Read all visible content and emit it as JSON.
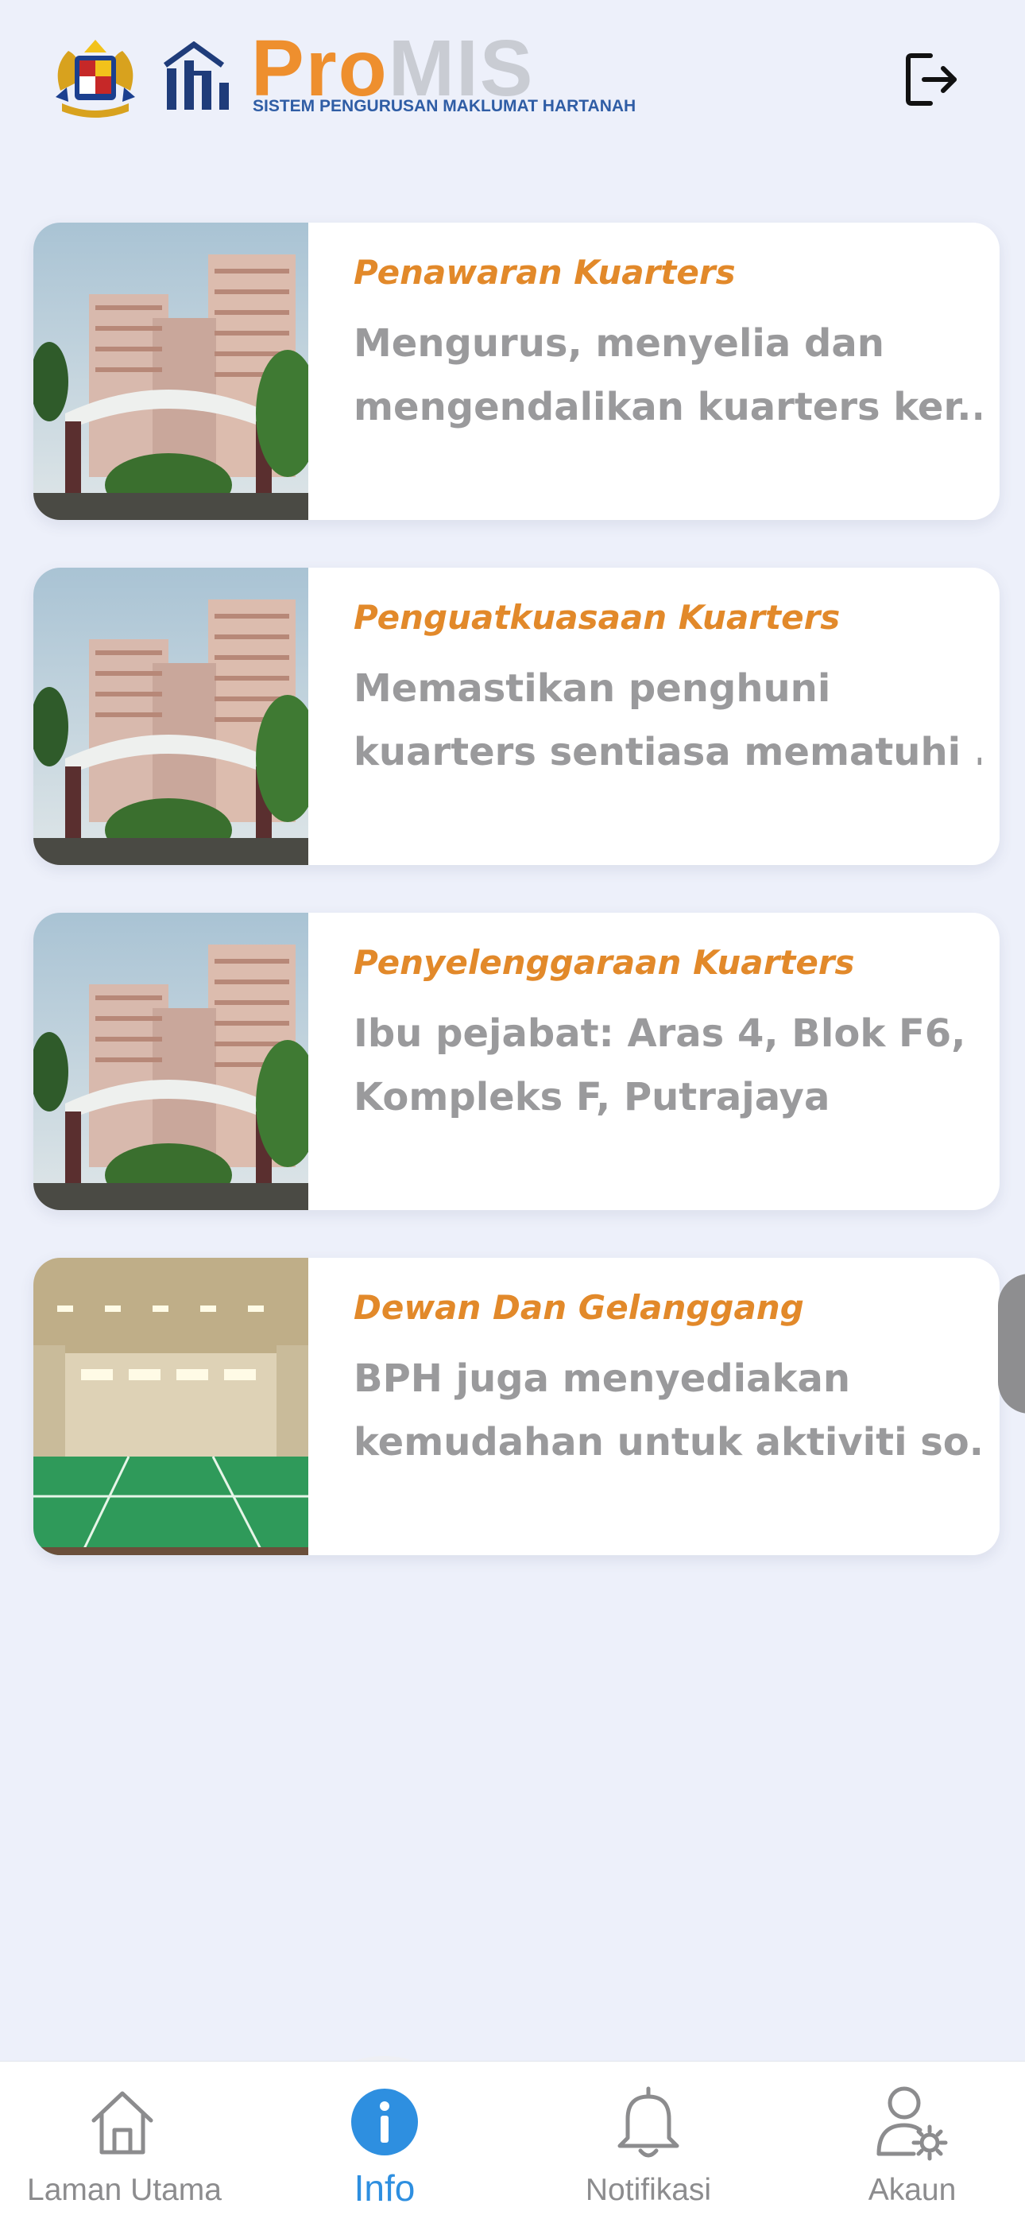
{
  "header": {
    "brand_pro": "Pro",
    "brand_mis": "MIS",
    "brand_subtitle": "SISTEM PENGURUSAN MAKLUMAT HARTANAH",
    "logout_icon": "logout-icon"
  },
  "cards": [
    {
      "title": "Penawaran Kuarters",
      "desc_line1": "Mengurus, menyelia dan",
      "desc_line2": "mengendalikan kuarters ker...",
      "image": "apartment-photo"
    },
    {
      "title": "Penguatkuasaan Kuarters",
      "desc_line1": "Memastikan penghuni",
      "desc_line2": "kuarters sentiasa mematuhi ...",
      "image": "apartment-photo"
    },
    {
      "title": "Penyelenggaraan Kuarters",
      "desc_line1": "Ibu pejabat: Aras 4, Blok F6,",
      "desc_line2": "Kompleks F, Putrajaya",
      "image": "apartment-photo"
    },
    {
      "title": "Dewan Dan Gelanggang",
      "desc_line1": "BPH juga menyediakan",
      "desc_line2": "kemudahan untuk aktiviti so...",
      "image": "sports-hall-photo"
    }
  ],
  "nav": {
    "items": [
      {
        "label": "Laman Utama",
        "icon": "home-icon",
        "active": false
      },
      {
        "label": "Info",
        "icon": "info-icon",
        "active": true
      },
      {
        "label": "Notifikasi",
        "icon": "bell-icon",
        "active": false
      },
      {
        "label": "Akaun",
        "icon": "account-settings-icon",
        "active": false
      }
    ]
  },
  "colors": {
    "background": "#edf0fa",
    "accent_orange": "#e2892a",
    "active_blue": "#2e8fe0",
    "muted_text": "#9a9a9c"
  }
}
